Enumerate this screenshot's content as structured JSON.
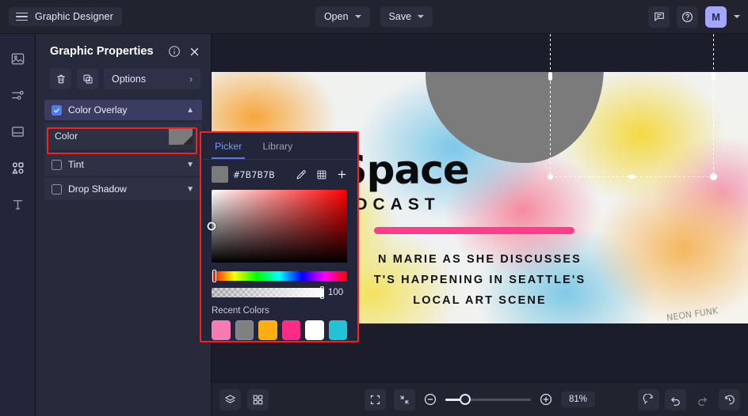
{
  "topbar": {
    "doc_title": "Graphic Designer",
    "menu_icon": "hamburger-icon",
    "open_label": "Open",
    "save_label": "Save",
    "comment_icon": "comment-icon",
    "help_icon": "help-circle-icon",
    "avatar_initial": "M",
    "avatar_color": "#a4a6f7"
  },
  "rail": {
    "items": [
      {
        "icon": "image-icon",
        "name": "sidebar-item-images"
      },
      {
        "icon": "adjustments-icon",
        "name": "sidebar-item-adjustments"
      },
      {
        "icon": "layout-icon",
        "name": "sidebar-item-layouts"
      },
      {
        "icon": "shapes-icon",
        "name": "sidebar-item-shapes"
      },
      {
        "icon": "text-icon",
        "name": "sidebar-item-text"
      }
    ]
  },
  "panel": {
    "title": "Graphic Properties",
    "info_icon": "info-circle-icon",
    "close_icon": "close-icon",
    "delete_icon": "trash-icon",
    "duplicate_icon": "duplicate-icon",
    "options_label": "Options",
    "options_chevron": "chevron-right-icon",
    "sections": [
      {
        "label": "Color Overlay",
        "checked": true,
        "active": true,
        "chevron": "chevron-up-icon"
      },
      {
        "label": "Tint",
        "checked": false,
        "active": false,
        "chevron": "chevron-down-icon"
      },
      {
        "label": "Drop Shadow",
        "checked": false,
        "active": false,
        "chevron": "chevron-down-icon"
      }
    ],
    "color_row": {
      "label": "Color",
      "swatch_hex": "#7B7B7B"
    }
  },
  "picker": {
    "tabs": [
      {
        "label": "Picker",
        "active": true
      },
      {
        "label": "Library",
        "active": false
      }
    ],
    "hex_value": "#7B7B7B",
    "eyedropper_icon": "eyedropper-icon",
    "palette_icon": "grid-palette-icon",
    "add_icon": "plus-icon",
    "alpha_value": "100",
    "recent_label": "Recent Colors",
    "recent_colors": [
      {
        "hex": "#f97bb4",
        "selected": false
      },
      {
        "hex": "#808080",
        "selected": true
      },
      {
        "hex": "#ffad12",
        "selected": false
      },
      {
        "hex": "#ff2b8a",
        "selected": false
      },
      {
        "hex": "#ffffff",
        "selected": false
      },
      {
        "hex": "#22c3d6",
        "selected": false
      }
    ]
  },
  "canvas": {
    "artwork_title": "Art Space",
    "artwork_subtitle": "PODCAST",
    "artwork_body_line1": "N MARIE AS SHE DISCUSSES",
    "artwork_body_line2": "T'S HAPPENING IN SEATTLE'S",
    "artwork_body_line3": "LOCAL ART SCENE",
    "graffiti_tag": "NEON FUNK",
    "overlay_color": "#7b7b7b"
  },
  "bottombar": {
    "layers_icon": "layers-icon",
    "grid_icon": "grid-icon",
    "fit_icon": "fit-frame-icon",
    "shrink_icon": "shrink-icon",
    "zoom_out_icon": "zoom-out-icon",
    "zoom_in_icon": "zoom-in-icon",
    "zoom_value": "81%",
    "reset_icon": "reset-icon",
    "undo_icon": "undo-icon",
    "redo_icon": "redo-icon",
    "history_icon": "history-icon"
  }
}
